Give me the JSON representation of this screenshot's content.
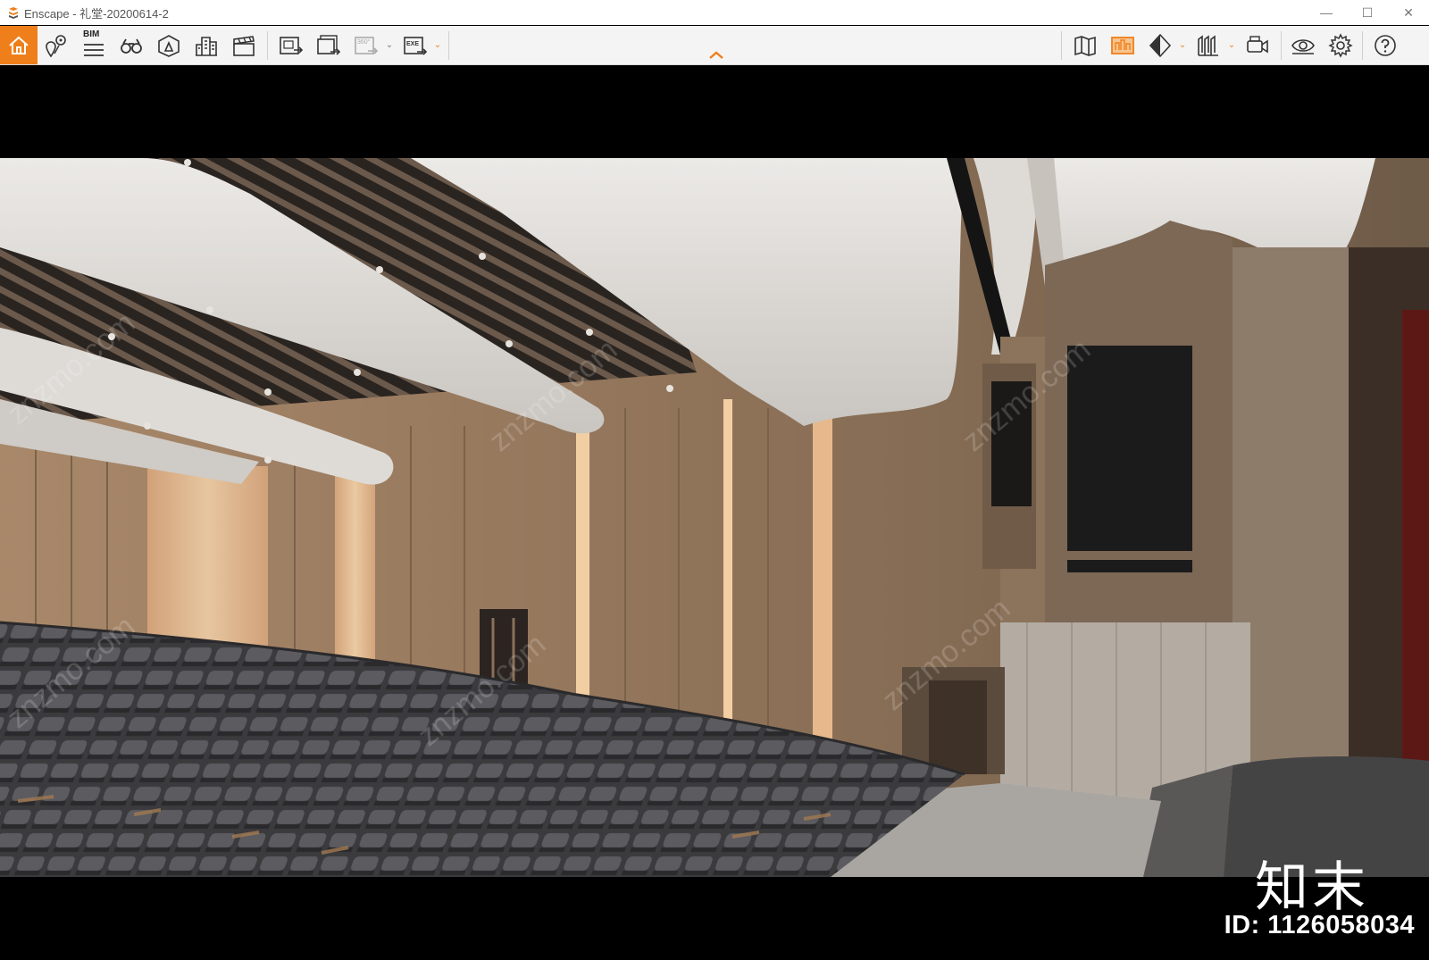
{
  "window": {
    "title": "Enscape - 礼堂-20200614-2",
    "minimize_glyph": "—",
    "maximize_glyph": "☐",
    "close_glyph": "✕"
  },
  "toolbar": {
    "accent_color": "#ef7f1a",
    "bim_label": "BIM",
    "left_tools": [
      "home-icon",
      "location-pin-icon",
      "bim-list-icon",
      "binoculars-icon",
      "asset-library-icon",
      "city-buildings-icon",
      "clapperboard-icon",
      "screenshot-export-icon",
      "batch-render-icon",
      "panorama-360-icon",
      "exe-export-icon"
    ],
    "right_tools": [
      "map-icon",
      "orange-building-view-icon",
      "contrast-icon",
      "walls-icon",
      "video-camera-icon",
      "eye-icon",
      "gear-icon",
      "help-icon"
    ]
  },
  "watermarks": {
    "brand": "知末",
    "id_label": "ID: 1126058034",
    "site": "znzmo.com"
  }
}
